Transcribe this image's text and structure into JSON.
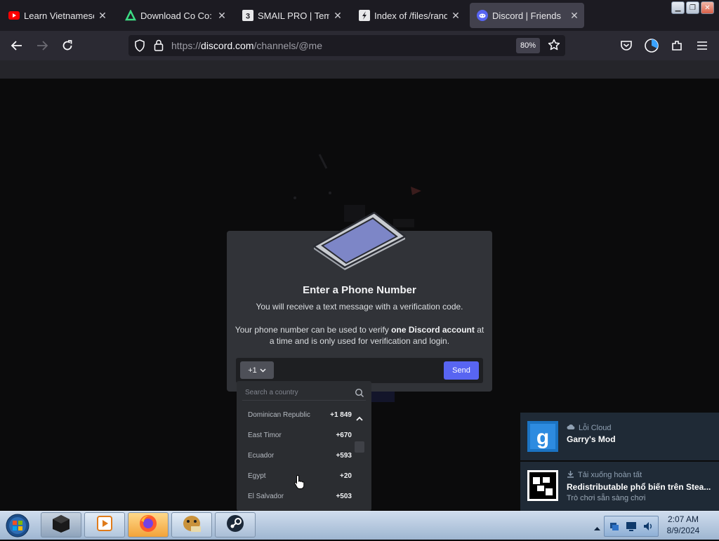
{
  "browser": {
    "tabs": [
      {
        "title": "Learn Vietnamese thr",
        "icon": "youtube-icon",
        "active": false
      },
      {
        "title": "Download Co Co: Ma",
        "icon": "android-icon",
        "active": false
      },
      {
        "title": "SMAIL PRO | Temp m",
        "icon": "smail-icon",
        "active": false
      },
      {
        "title": "Index of /files/rando",
        "icon": "file-index-icon",
        "active": false
      },
      {
        "title": "Discord | Friends",
        "icon": "discord-icon",
        "active": true
      }
    ],
    "url": {
      "prefix": "https://",
      "host": "discord.com",
      "path": "/channels/@me"
    },
    "zoom": "80%"
  },
  "modal": {
    "title": "Enter a Phone Number",
    "subtitle": "You will receive a text message with a verification code.",
    "desc_before": "Your phone number can be used to verify ",
    "desc_bold": "one Discord account",
    "desc_after": " at a time and is only used for verification and login.",
    "country_code": "+1",
    "phone_value": "",
    "send_label": "Send"
  },
  "dropdown": {
    "search_placeholder": "Search a country",
    "countries": [
      {
        "name": "Dominican Republic",
        "code": "+1 849"
      },
      {
        "name": "East Timor",
        "code": "+670"
      },
      {
        "name": "Ecuador",
        "code": "+593"
      },
      {
        "name": "Egypt",
        "code": "+20"
      },
      {
        "name": "El Salvador",
        "code": "+503"
      }
    ]
  },
  "notifications": [
    {
      "heading": "Lỗi Cloud",
      "name": "Garry's Mod",
      "sub": "",
      "icon": "cloud-icon"
    },
    {
      "heading": "Tải xuống hoàn tất",
      "name": "Redistributable phổ biến trên Stea...",
      "sub": "Trò chơi sẵn sàng chơi",
      "icon": "download-icon"
    }
  ],
  "taskbar": {
    "time": "2:07 AM",
    "date": "8/9/2024"
  },
  "colors": {
    "discord_blurple": "#5865f2",
    "modal_bg": "#313338",
    "input_bg": "#1e1f22",
    "steam_notif_bg": "#1f2a36"
  }
}
